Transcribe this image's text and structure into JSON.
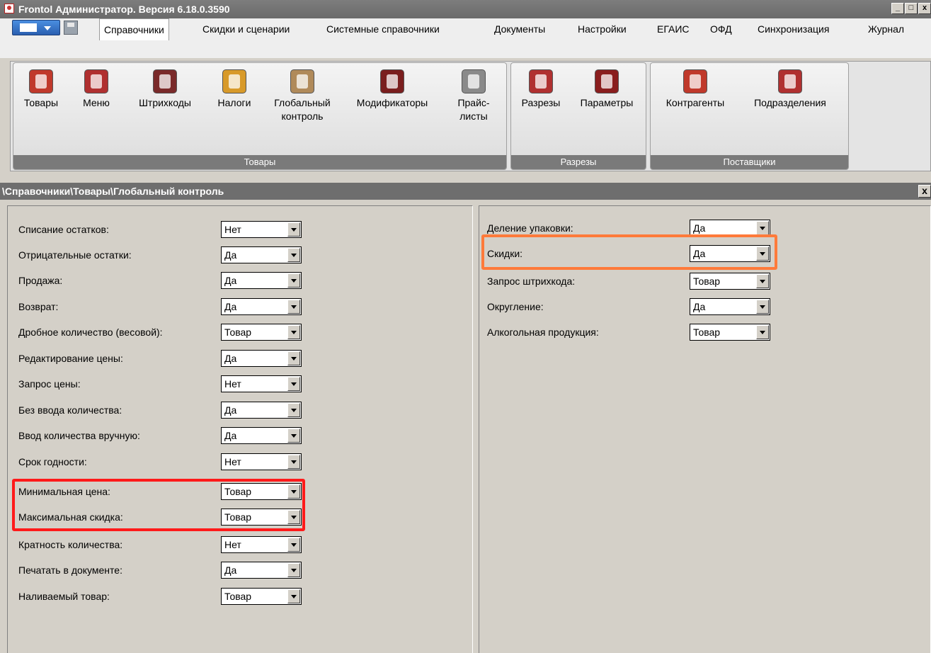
{
  "window": {
    "title": "Frontol Администратор. Версия 6.18.0.3590",
    "controls": [
      "_",
      "□",
      "x"
    ]
  },
  "menu": {
    "tabs": [
      {
        "label": "Справочники",
        "active": true
      },
      {
        "label": "Скидки и сценарии"
      },
      {
        "label": "Системные справочники"
      },
      {
        "label": "Документы"
      },
      {
        "label": "Настройки"
      },
      {
        "label": "ЕГАИС"
      },
      {
        "label": "ОФД"
      },
      {
        "label": "Синхронизация"
      },
      {
        "label": "Журнал"
      }
    ]
  },
  "ribbon": {
    "groups": [
      {
        "label": "Товары"
      },
      {
        "label": "Разрезы"
      },
      {
        "label": "Поставщики"
      }
    ],
    "buttons": [
      {
        "line1": "Товары",
        "line2": "",
        "icon": "bottle-icon",
        "color": "#c0392b"
      },
      {
        "line1": "Меню",
        "line2": "",
        "icon": "menu-book-icon",
        "color": "#b03030"
      },
      {
        "line1": "Штрихкоды",
        "line2": "",
        "icon": "barcode-icon",
        "color": "#7a2a2a"
      },
      {
        "line1": "Налоги",
        "line2": "",
        "icon": "coins-icon",
        "color": "#d89a2a"
      },
      {
        "line1": "Глобальный",
        "line2": "контроль",
        "icon": "box-tools-icon",
        "color": "#b08a5a"
      },
      {
        "line1": "Модификаторы",
        "line2": "",
        "icon": "bottles-icon",
        "color": "#7a1e1e"
      },
      {
        "line1": "Прайс-",
        "line2": "листы",
        "icon": "pricelist-icon",
        "color": "#8a8a8a"
      },
      {
        "line1": "Разрезы",
        "line2": "",
        "icon": "cubes-icon",
        "color": "#b03030"
      },
      {
        "line1": "Параметры",
        "line2": "",
        "icon": "tools-icon",
        "color": "#8a1e1e"
      },
      {
        "line1": "Контрагенты",
        "line2": "",
        "icon": "worker-icon",
        "color": "#c0392b"
      },
      {
        "line1": "Подразделения",
        "line2": "",
        "icon": "store-icon",
        "color": "#b03030"
      }
    ]
  },
  "path": {
    "text": "\\Справочники\\Товары\\Глобальный контроль",
    "close": "x"
  },
  "left_settings": [
    {
      "label": "Списание остатков:",
      "value": "Нет"
    },
    {
      "label": "Отрицательные остатки:",
      "value": "Да"
    },
    {
      "label": "Продажа:",
      "value": "Да"
    },
    {
      "label": "Возврат:",
      "value": "Да"
    },
    {
      "label": "Дробное количество (весовой):",
      "value": "Товар"
    },
    {
      "label": "Редактирование цены:",
      "value": "Да"
    },
    {
      "label": "Запрос цены:",
      "value": "Нет"
    },
    {
      "label": "Без ввода количества:",
      "value": "Да"
    },
    {
      "label": "Ввод количества вручную:",
      "value": "Да"
    },
    {
      "label": "Срок годности:",
      "value": "Нет"
    },
    {
      "label": "Минимальная цена:",
      "value": "Товар"
    },
    {
      "label": "Максимальная скидка:",
      "value": "Товар"
    },
    {
      "label": "Кратность количества:",
      "value": "Нет"
    },
    {
      "label": "Печатать в документе:",
      "value": "Да"
    },
    {
      "label": "Наливаемый товар:",
      "value": "Товар"
    }
  ],
  "right_settings": [
    {
      "label": "Деление упаковки:",
      "value": "Да"
    },
    {
      "label": "Скидки:",
      "value": "Да"
    },
    {
      "label": "Запрос штрихкода:",
      "value": "Товар"
    },
    {
      "label": "Округление:",
      "value": "Да"
    },
    {
      "label": "Алкогольная продукция:",
      "value": "Товар"
    }
  ],
  "colors": {
    "highlight_red": "#ff1a1a",
    "highlight_orange": "#ff7a3a"
  }
}
